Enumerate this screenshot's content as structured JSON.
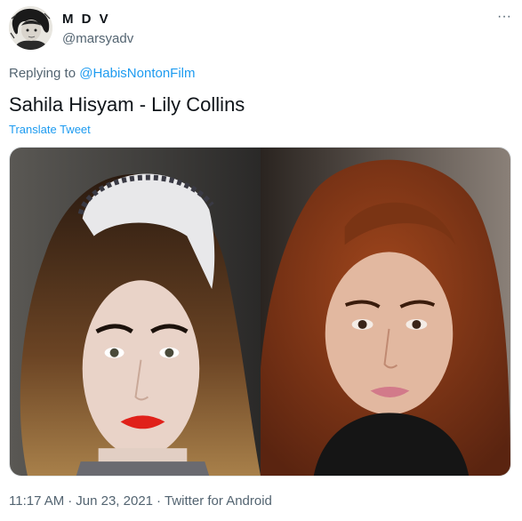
{
  "author": {
    "display_name": "M D V",
    "handle": "@marsyadv",
    "avatar_icon": "user-avatar"
  },
  "more_icon": "more-horizontal-icon",
  "more_glyph": "···",
  "reply": {
    "prefix": "Replying to",
    "mention": "@HabisNontonFilm"
  },
  "tweet": {
    "text": "Sahila Hisyam - Lily Collins",
    "translate_label": "Translate Tweet"
  },
  "media": {
    "count": 2,
    "items": [
      "photo-left",
      "photo-right"
    ]
  },
  "meta": {
    "time": "11:17 AM",
    "separator": "·",
    "date": "Jun 23, 2021",
    "source": "Twitter for Android"
  },
  "colors": {
    "link": "#1d9bf0",
    "secondary_text": "#536471",
    "primary_text": "#0f1419"
  }
}
